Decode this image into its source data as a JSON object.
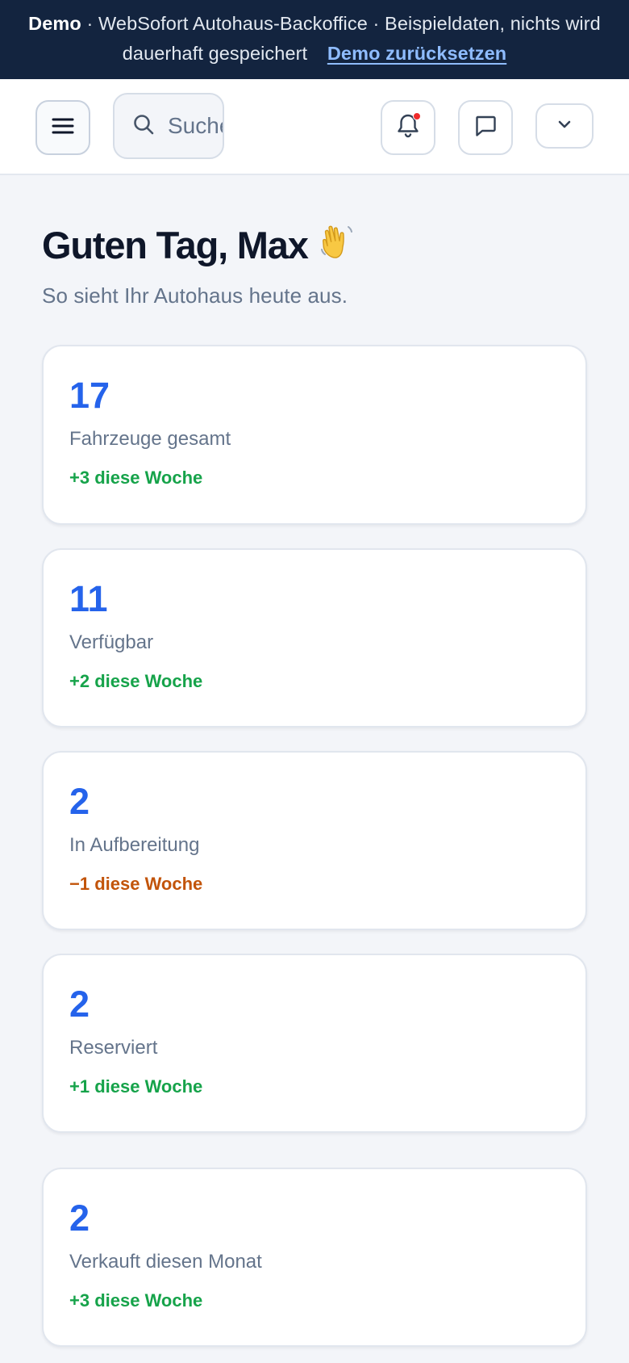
{
  "banner": {
    "demo_label": "Demo",
    "text": "· WebSofort Autohaus-Backoffice · Beispieldaten, nichts wird dauerhaft gespeichert",
    "reset_link": "Demo zurücksetzen"
  },
  "topbar": {
    "search_placeholder": "Suchen",
    "notification_dot_color": "#ef2b2b"
  },
  "greeting": {
    "title": "Guten Tag, Max",
    "emoji": "👋",
    "subtitle": "So sieht Ihr Autohaus heute aus."
  },
  "stats": [
    {
      "value": "17",
      "label": "Fahrzeuge gesamt",
      "delta": "+3 diese Woche",
      "trend": "up"
    },
    {
      "value": "11",
      "label": "Verfügbar",
      "delta": "+2 diese Woche",
      "trend": "up"
    },
    {
      "value": "2",
      "label": "In Aufbereitung",
      "delta": "−1 diese Woche",
      "trend": "down"
    },
    {
      "value": "2",
      "label": "Reserviert",
      "delta": "+1 diese Woche",
      "trend": "up"
    },
    {
      "value": "2",
      "label": "Verkauft diesen Monat",
      "delta": "+3 diese Woche",
      "trend": "up"
    }
  ],
  "colors": {
    "banner_bg": "#13243f",
    "accent": "#2563eb",
    "positive": "#16a34a",
    "negative": "#c2540a"
  },
  "icons": {
    "menu": "hamburger-icon",
    "search": "search-icon",
    "notifications": "bell-icon",
    "messages": "chat-icon",
    "user_menu": "chevron-down-icon"
  }
}
